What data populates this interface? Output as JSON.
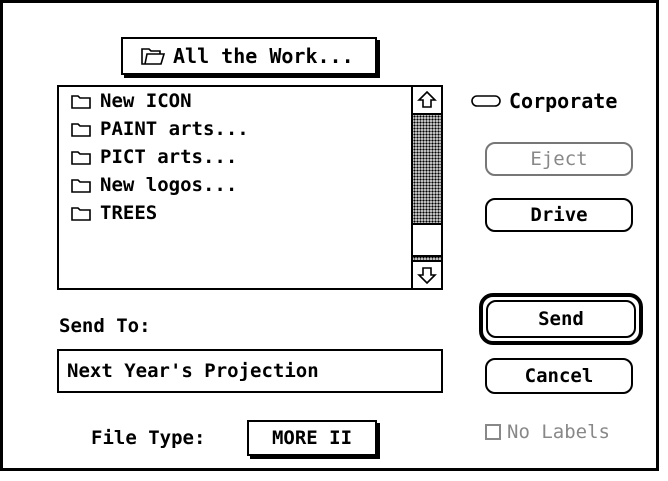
{
  "folder_popup": {
    "label": "All the Work...",
    "icon": "open-folder-icon"
  },
  "file_list": {
    "items": [
      {
        "label": "New ICON",
        "icon": "folder-icon"
      },
      {
        "label": "PAINT arts...",
        "icon": "folder-icon"
      },
      {
        "label": "PICT arts...",
        "icon": "folder-icon"
      },
      {
        "label": "New logos...",
        "icon": "folder-icon"
      },
      {
        "label": "TREES",
        "icon": "folder-icon"
      }
    ]
  },
  "volume": {
    "label": "Corporate",
    "icon": "disk-icon"
  },
  "buttons": {
    "eject": "Eject",
    "drive": "Drive",
    "send": "Send",
    "cancel": "Cancel"
  },
  "send_to": {
    "label": "Send To:",
    "value": "Next Year's Projection"
  },
  "file_type": {
    "label": "File Type:",
    "value": "MORE II"
  },
  "no_labels": {
    "label": "No Labels",
    "checked": false,
    "enabled": false
  }
}
